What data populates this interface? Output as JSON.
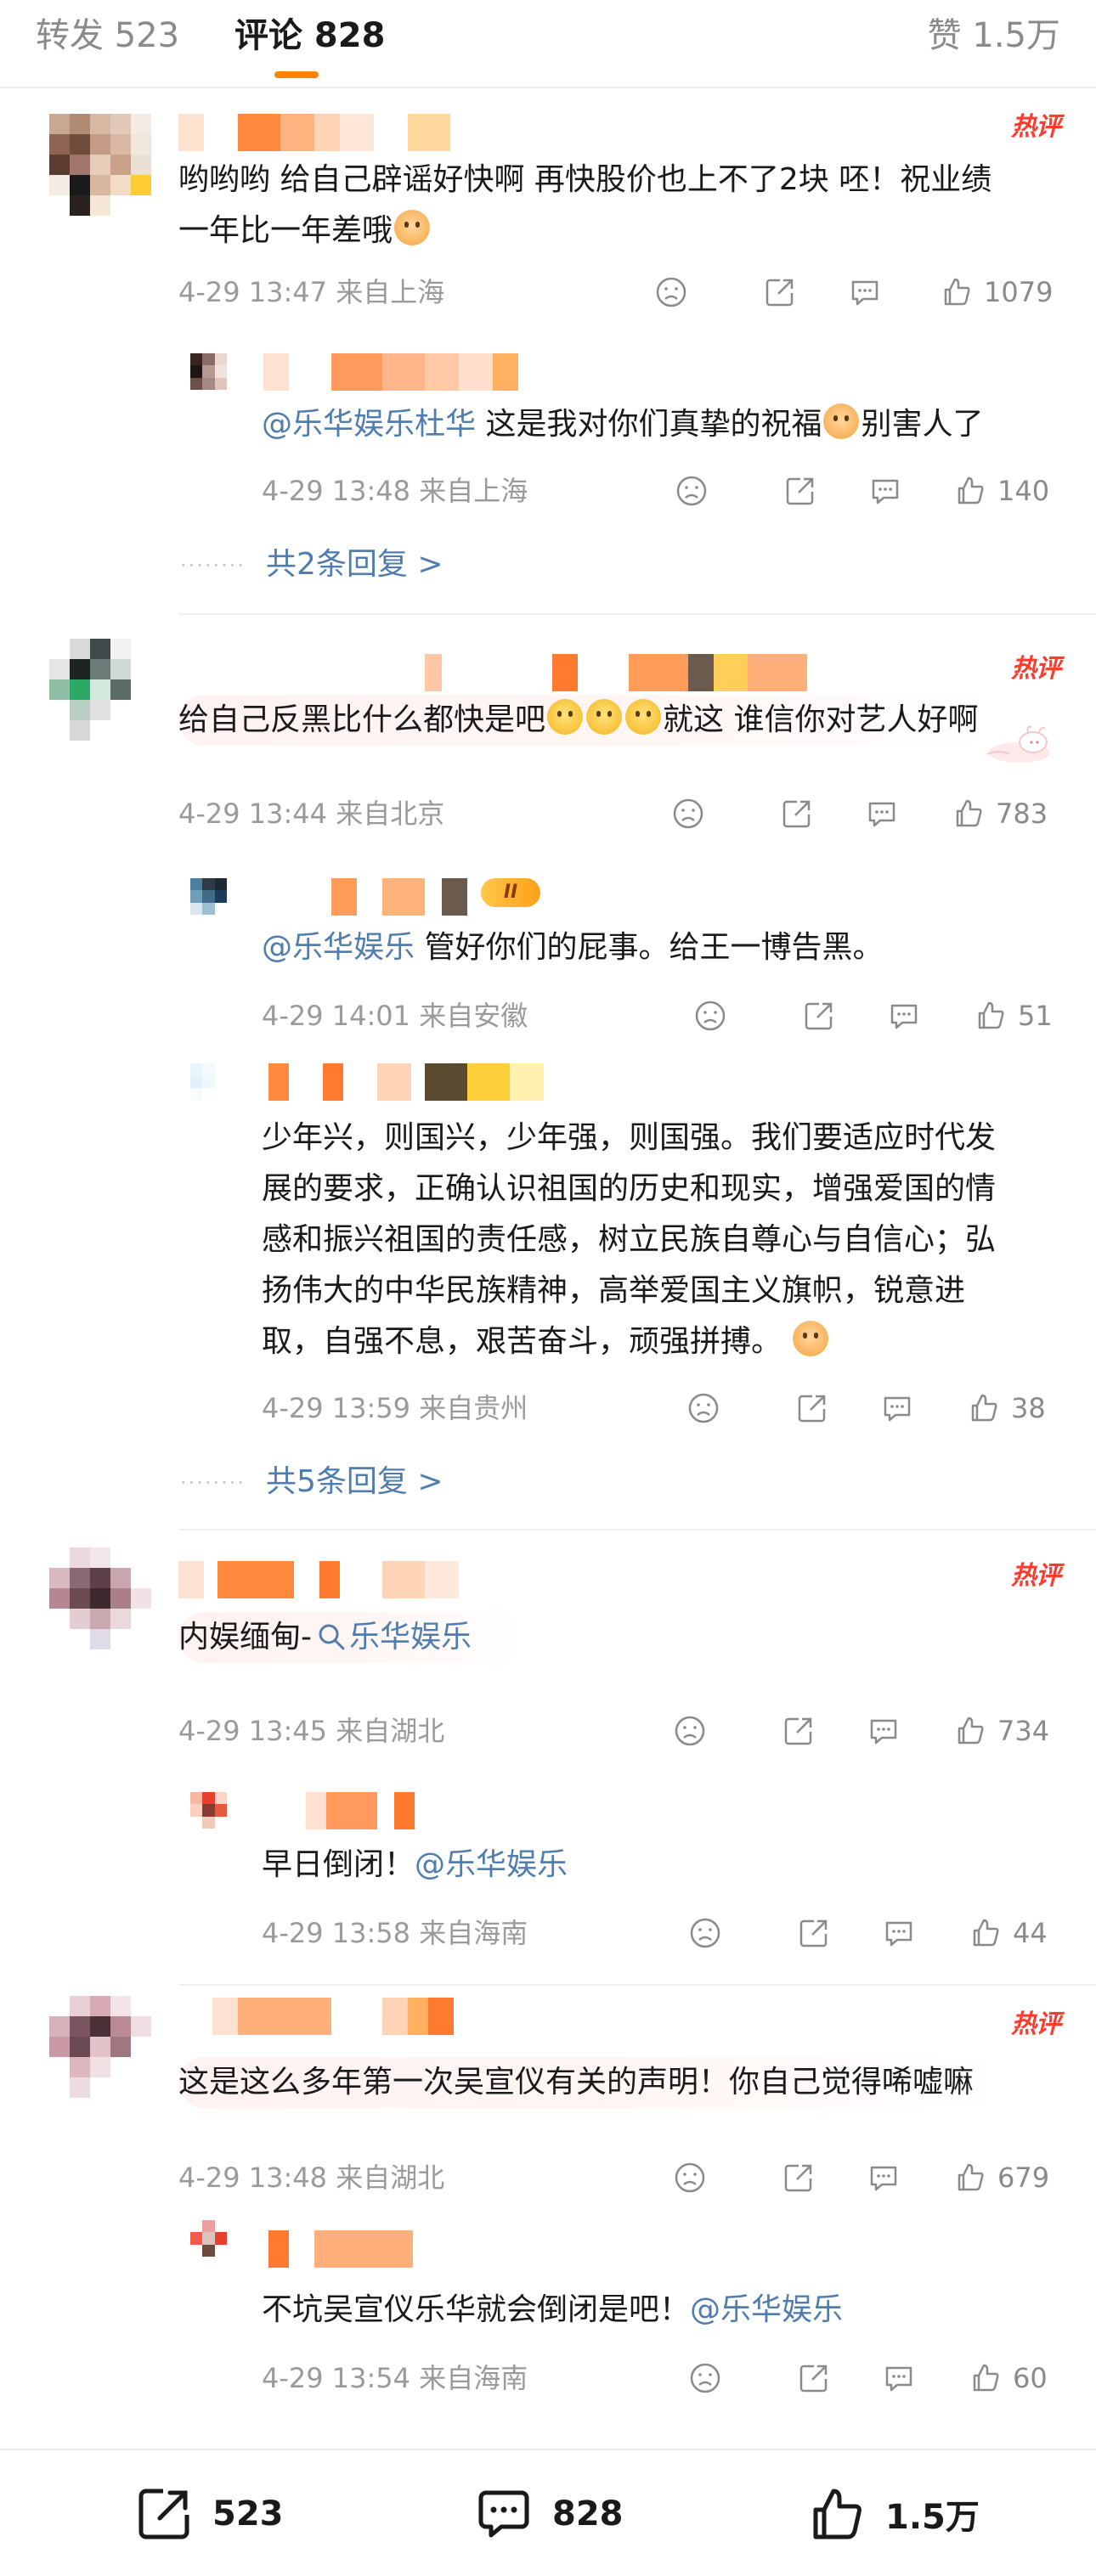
{
  "tabs": {
    "repost": "转发 523",
    "comment": "评论 828",
    "like": "赞 1.5万"
  },
  "hot_label": "热评",
  "colors": {
    "accent": "#ff8200",
    "link": "#507daf",
    "hot": "#ff3b30"
  },
  "comments": [
    {
      "text": "哟哟哟 给自己辟谣好快啊 再快股价也上不了2块 呸！祝业绩一年比一年差哦",
      "text_line1": "哟哟哟 给自己辟谣好快啊 再快股价也上不了2块 呸！祝业绩",
      "text_line2": "一年比一年差哦",
      "meta": "4-29 13:47  来自上海",
      "likes": "1079",
      "replies": [
        {
          "mention": "@乐华娱乐杜华",
          "text": " 这是我对你们真挚的祝福",
          "text_tail": "别害人了",
          "meta": "4-29 13:48  来自上海",
          "likes": "140"
        }
      ],
      "more": "共2条回复 >"
    },
    {
      "text_before_emoji": "给自己反黑比什么都快是吧",
      "text_after_emoji": "就这 谁信你对艺人好啊",
      "meta": "4-29 13:44  来自北京",
      "likes": "783",
      "replies": [
        {
          "level_badge": "II",
          "mention": "@乐华娱乐",
          "text": " 管好你们的屁事。给王一博告黑。",
          "meta": "4-29 14:01  来自安徽",
          "likes": "51"
        },
        {
          "lines": [
            "少年兴，则国兴，少年强，则国强。我们要适应时代发",
            "展的要求，正确认识祖国的历史和现实，增强爱国的情",
            "感和振兴祖国的责任感，树立民族自尊心与自信心；弘",
            "扬伟大的中华民族精神，高举爱国主义旗帜，锐意进",
            "取，自强不息，艰苦奋斗，顽强拼搏。"
          ],
          "meta": "4-29 13:59  来自贵州",
          "likes": "38"
        }
      ],
      "more": "共5条回复 >"
    },
    {
      "text": "内娱缅甸-",
      "search_link": "乐华娱乐",
      "meta": "4-29 13:45  来自湖北",
      "likes": "734",
      "replies": [
        {
          "text": "早日倒闭！",
          "mention": "@乐华娱乐",
          "meta": "4-29 13:58  来自海南",
          "likes": "44"
        }
      ]
    },
    {
      "text": "这是这么多年第一次吴宣仪有关的声明！你自己觉得唏嘘嘛",
      "meta": "4-29 13:48  来自湖北",
      "likes": "679",
      "replies": [
        {
          "text": "不坑吴宣仪乐华就会倒闭是吧！",
          "mention": "@乐华娱乐",
          "meta": "4-29 13:54  来自海南",
          "likes": "60"
        }
      ]
    }
  ],
  "bottom": {
    "repost": "523",
    "comment": "828",
    "like": "1.5万"
  },
  "icons": [
    "dislike-icon",
    "share-icon",
    "comment-icon",
    "like-icon",
    "search-icon"
  ]
}
